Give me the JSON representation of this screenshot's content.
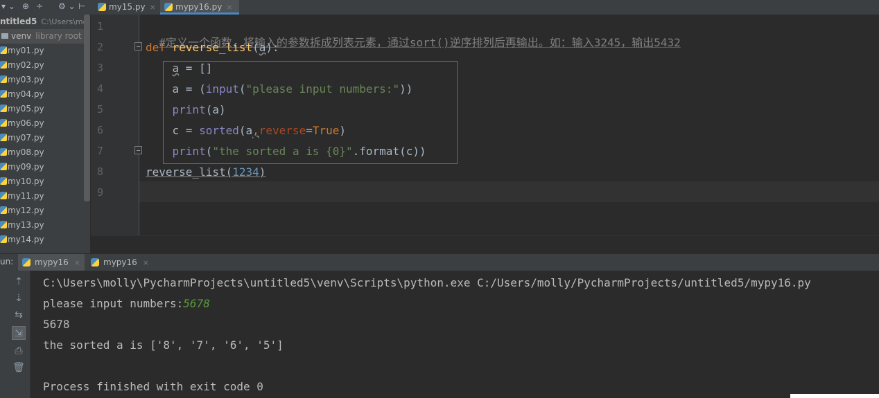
{
  "project_toolbar": {
    "icons": [
      "dropdown-icon",
      "add-icon",
      "collapse-icon",
      "gear-icon",
      "hide-icon"
    ]
  },
  "tabs": [
    {
      "label": "my15.py",
      "active": false,
      "close": "×"
    },
    {
      "label": "mypy16.py",
      "active": true,
      "close": "×"
    }
  ],
  "sidebar": {
    "root": {
      "name": "ntitled5",
      "path": "C:\\Users\\mol"
    },
    "venv": {
      "name": "venv",
      "hint": "library root"
    },
    "files": [
      "my01.py",
      "my02.py",
      "my03.py",
      "my04.py",
      "my05.py",
      "my06.py",
      "my07.py",
      "my08.py",
      "my09.py",
      "my10.py",
      "my11.py",
      "my12.py",
      "my13.py",
      "my14.py"
    ]
  },
  "editor": {
    "line_numbers": [
      "1",
      "2",
      "3",
      "4",
      "5",
      "6",
      "7",
      "8",
      "9"
    ],
    "line1": {
      "comment": "#定义一个函数，将输入的参数拆成列表元素，通过sort()逆序排列后再输出。如：输入3245，输出5432"
    },
    "line2": {
      "def": "def",
      "name": "reverse_list",
      "open": "(",
      "param": "a",
      "close": "):"
    },
    "line3": {
      "var": "a",
      "rest": " = []"
    },
    "line4": {
      "lhs": "a = (",
      "fn": "input",
      "open": "(",
      "str": "\"please input numbers:\"",
      "close": "))"
    },
    "line5": {
      "fn": "print",
      "rest": "(a)"
    },
    "line6": {
      "lhs": "c = ",
      "fn": "sorted",
      "open": "(a",
      "comma": ",",
      "kwarg": "reverse",
      "eq": "=",
      "val": "True",
      "close": ")"
    },
    "line7": {
      "fn": "print",
      "open": "(",
      "str": "\"the sorted a is {0}\"",
      "rest": ".format(c))"
    },
    "line8": {
      "call": "reverse_list",
      "open": "(",
      "num": "1234",
      "close": ")"
    }
  },
  "run": {
    "label": "un:",
    "tabs": [
      {
        "label": "mypy16",
        "active": true,
        "close": "×"
      },
      {
        "label": "mypy16",
        "active": false,
        "close": "×"
      }
    ],
    "toolbar_icons": [
      "arrow-up-icon",
      "arrow-down-icon",
      "soft-wrap-icon",
      "scroll-to-end-icon",
      "print-icon",
      "trash-icon"
    ],
    "console": {
      "command": "C:\\Users\\molly\\PycharmProjects\\untitled5\\venv\\Scripts\\python.exe C:/Users/molly/PycharmProjects/untitled5/mypy16.py",
      "prompt": "please input numbers:",
      "user_input": "5678",
      "echo": "5678",
      "result": "the sorted a is ['8', '7', '6', '5']",
      "exit": "Process finished with exit code 0"
    }
  },
  "colors": {
    "keyword": "#cc7832",
    "function_name": "#ffc66d",
    "builtin": "#8888c6",
    "string": "#6a8759",
    "number": "#6897bb",
    "keyword_arg": "#aa4926",
    "comment": "#808080",
    "highlight_box": "#e53935"
  }
}
